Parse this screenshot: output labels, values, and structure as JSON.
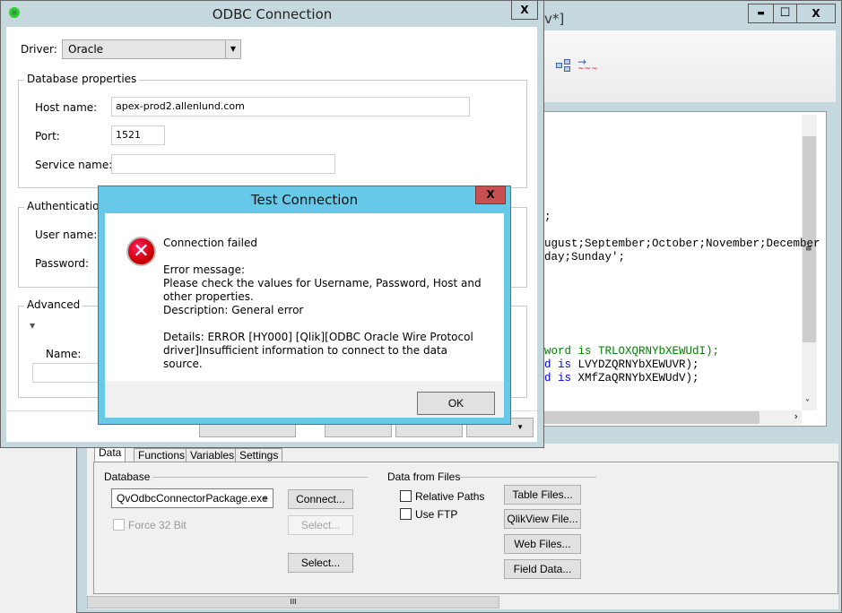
{
  "main_window": {
    "title_fragment": "v*]",
    "controls": {
      "minimize": "▬",
      "maximize": "☐",
      "close": "X"
    },
    "code_lines": [
      {
        "text": ";",
        "color": "#000000"
      },
      {
        "text": "ugust;September;October;November;December",
        "color": "#000000"
      },
      {
        "text": "day;Sunday';",
        "color": "#000000"
      },
      {
        "prefix": "word is ",
        "text": "TRLOXQRNYbXEWUdI);",
        "color": "#008000"
      },
      {
        "prefix": "d is ",
        "text": "LVYDZQRNYbXEWUVR);",
        "color": "#000000"
      },
      {
        "prefix": "d is ",
        "text": "XMfZaQRNYbXEWUdV);",
        "color": "#000000"
      }
    ],
    "tabs": [
      "Data",
      "Functions",
      "Variables",
      "Settings"
    ],
    "database": {
      "label": "Database",
      "connector": "QvOdbcConnectorPackage.exe",
      "force32": "Force 32 Bit",
      "connect": "Connect...",
      "select_disabled": "Select...",
      "select": "Select..."
    },
    "files": {
      "label": "Data from Files",
      "relative_paths": "Relative Paths",
      "use_ftp": "Use FTP",
      "buttons": [
        "Table Files...",
        "QlikView File...",
        "Web Files...",
        "Field Data..."
      ]
    }
  },
  "odbc": {
    "title": "ODBC Connection",
    "close": "X",
    "driver_label": "Driver:",
    "driver_value": "Oracle",
    "db_props": "Database properties",
    "host_label": "Host name:",
    "host_value": "apex-prod2.allenlund.com",
    "port_label": "Port:",
    "port_value": "1521",
    "service_label": "Service name:",
    "service_value": "",
    "auth": "Authentication",
    "user_label": "User name:",
    "password_label": "Password:",
    "advanced": "Advanced",
    "name_label": "Name:"
  },
  "test": {
    "title": "Test Connection",
    "close": "X",
    "heading": "Connection failed",
    "error_label": "Error message:",
    "message": "Please check the values for Username, Password, Host and other properties.",
    "description": "Description: General error",
    "details": "Details: ERROR [HY000] [Qlik][ODBC Oracle Wire Protocol driver]Insufficient information to connect to the data source.",
    "ok": "OK"
  }
}
